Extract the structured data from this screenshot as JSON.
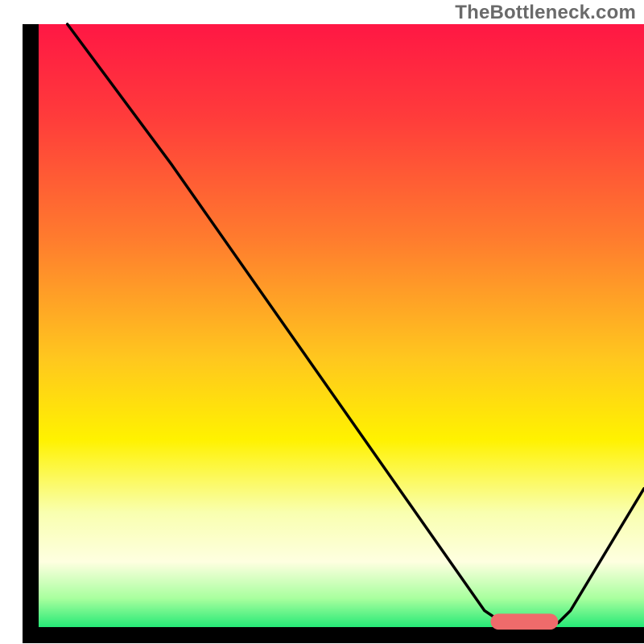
{
  "watermark": "TheBottleneck.com",
  "chart_data": {
    "type": "line",
    "xlim": [
      0,
      100
    ],
    "ylim": [
      0,
      100
    ],
    "gradient_stops": [
      {
        "offset": 0,
        "color": "#ff1744"
      },
      {
        "offset": 15,
        "color": "#ff3b3b"
      },
      {
        "offset": 35,
        "color": "#ff7b2e"
      },
      {
        "offset": 55,
        "color": "#ffc81e"
      },
      {
        "offset": 68,
        "color": "#fff200"
      },
      {
        "offset": 80,
        "color": "#f9ffb0"
      },
      {
        "offset": 88,
        "color": "#feffe0"
      },
      {
        "offset": 94,
        "color": "#a8ff9e"
      },
      {
        "offset": 100,
        "color": "#00e36b"
      }
    ],
    "curve": [
      {
        "x": 6,
        "y": 100
      },
      {
        "x": 23,
        "y": 77
      },
      {
        "x": 74,
        "y": 4
      },
      {
        "x": 77,
        "y": 2
      },
      {
        "x": 86,
        "y": 2
      },
      {
        "x": 88,
        "y": 4
      },
      {
        "x": 100,
        "y": 24
      }
    ],
    "marker": {
      "x_start": 75,
      "x_end": 86,
      "y": 2.2,
      "color": "#ef6b6b",
      "thickness": 2.6
    },
    "axes": {
      "left": {
        "x": 3.5
      },
      "bottom": {
        "y": 0.5
      }
    }
  }
}
